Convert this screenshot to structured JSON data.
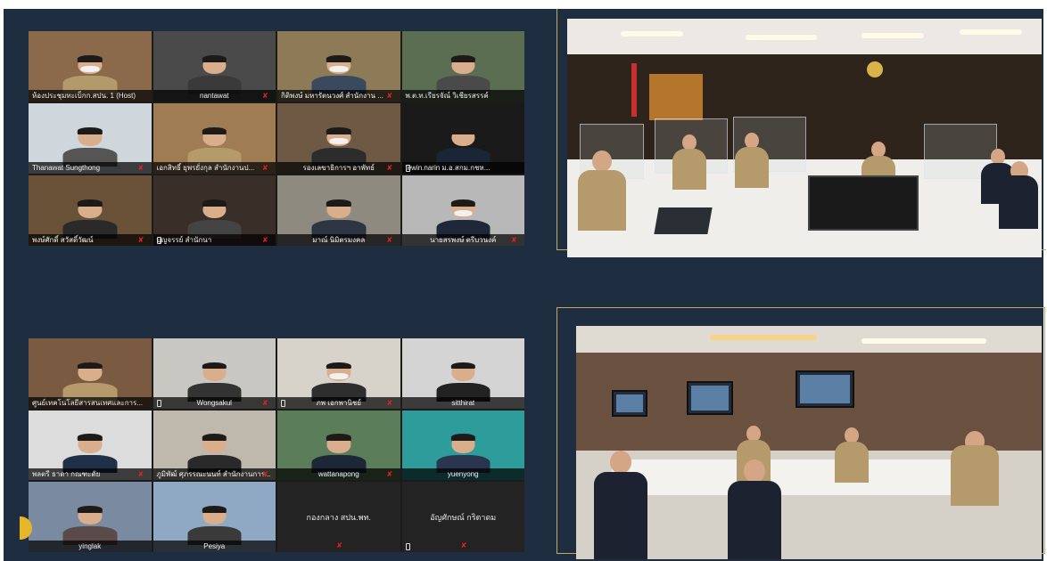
{
  "grid_top": [
    {
      "name": "ห้องประชุมทะเบ็กก.สปน. 1 (Host)",
      "scene": "#8a6a4a",
      "torso": "#b49a6a",
      "mask": true,
      "muted": false,
      "phone": false,
      "align": "left"
    },
    {
      "name": "nantawat",
      "scene": "#4a4a4a",
      "torso": "#3a3a3a",
      "mask": false,
      "muted": true,
      "phone": false,
      "align": "center"
    },
    {
      "name": "กิติพงษ์ มหารัตนวงศ์ สำนักงาน ...",
      "scene": "#8d7b58",
      "torso": "#3a4a5e",
      "mask": true,
      "muted": true,
      "phone": false,
      "align": "left"
    },
    {
      "name": "พ.ต.ท.เรียรจัณ์ วิเชียรสรรค์",
      "scene": "#5c6e52",
      "torso": "#4a4a4a",
      "mask": false,
      "muted": false,
      "phone": false,
      "align": "left"
    },
    {
      "name": "Thanawat Sungthong",
      "scene": "#cfd6dc",
      "torso": "#555",
      "mask": false,
      "muted": true,
      "phone": false,
      "align": "left"
    },
    {
      "name": "เอกสิทธิ์ ยุพรยั่งกุล สำนักงานป...",
      "scene": "#a07c55",
      "torso": "#b59a6c",
      "mask": false,
      "muted": true,
      "phone": false,
      "align": "left"
    },
    {
      "name": "รองเลขาธิการฯ อาพัทธ์",
      "scene": "#6d5944",
      "torso": "#2c2c2c",
      "mask": true,
      "muted": true,
      "phone": false,
      "align": "center"
    },
    {
      "name": "tewin.narin ม.อ.สกม.กชห...",
      "scene": "#1a1a1a",
      "torso": "#1a2535",
      "mask": false,
      "muted": false,
      "phone": true,
      "align": "left"
    },
    {
      "name": "พงษ์ศักดิ์ สวัสดิ์วัฒน์",
      "scene": "#6a5238",
      "torso": "#2a2a2a",
      "mask": false,
      "muted": true,
      "phone": false,
      "align": "left"
    },
    {
      "name": "บุญจรรย์ สำนักนา",
      "scene": "#3a2e28",
      "torso": "#444",
      "mask": false,
      "muted": true,
      "phone": true,
      "align": "left"
    },
    {
      "name": "มาณ์ นิมิตรมงคล",
      "scene": "#8f8a80",
      "torso": "#2e3644",
      "mask": false,
      "muted": true,
      "phone": false,
      "align": "center"
    },
    {
      "name": "นายสรพงษ์ ตรีบวนงค์",
      "scene": "#b8b8b8",
      "torso": "#1f2838",
      "mask": true,
      "muted": true,
      "phone": false,
      "align": "center"
    }
  ],
  "grid_bottom": [
    {
      "name": "ศูนย์เทคโนโลยีสารสนเทศและการ...",
      "scene": "#7b5a42",
      "torso": "#b59a6c",
      "mask": false,
      "muted": false,
      "phone": false,
      "align": "left",
      "empty": false
    },
    {
      "name": "Wongsakul",
      "scene": "#c9c7c2",
      "torso": "#333",
      "mask": false,
      "muted": true,
      "phone": true,
      "align": "center",
      "empty": false
    },
    {
      "name": "ภพ เอกพานิชย์",
      "scene": "#d7d2ca",
      "torso": "#2e2e2e",
      "mask": true,
      "muted": true,
      "phone": true,
      "align": "center",
      "empty": false
    },
    {
      "name": "sitthirat",
      "scene": "#d4d4d4",
      "torso": "#222",
      "mask": false,
      "muted": false,
      "phone": false,
      "align": "center",
      "empty": false
    },
    {
      "name": "พลตรี ธาดา กณฑะดัย",
      "scene": "#dcdcdc",
      "torso": "#203048",
      "mask": false,
      "muted": true,
      "phone": false,
      "align": "left",
      "empty": false
    },
    {
      "name": "ภูมิพัฒ์ ศุภรรณะนนท์ สำนักงานการ...",
      "scene": "#bfb8ad",
      "torso": "#2a2a2a",
      "mask": false,
      "muted": true,
      "phone": false,
      "align": "left",
      "empty": false
    },
    {
      "name": "wattanapong",
      "scene": "#5b7d5a",
      "torso": "#1c2738",
      "mask": false,
      "muted": true,
      "phone": false,
      "align": "center",
      "empty": false
    },
    {
      "name": "yuenyong",
      "scene": "#2e9c9a",
      "torso": "#2a3550",
      "mask": false,
      "muted": false,
      "phone": false,
      "align": "center",
      "empty": false
    },
    {
      "name": "yinglak",
      "scene": "#7a8aa0",
      "torso": "#5a4a4a",
      "mask": false,
      "muted": false,
      "phone": false,
      "align": "center",
      "empty": false
    },
    {
      "name": "Pesiya",
      "scene": "#8fa8c4",
      "torso": "#3a3a3a",
      "mask": false,
      "muted": false,
      "phone": false,
      "align": "center",
      "empty": false
    },
    {
      "name": "กองกลาง สปน.พท.",
      "scene": "#232323",
      "torso": "#232323",
      "mask": false,
      "muted": true,
      "phone": false,
      "align": "center",
      "empty": true
    },
    {
      "name": "อัญศักษณ์ กริตาดม",
      "scene": "#232323",
      "torso": "#232323",
      "mask": false,
      "muted": true,
      "phone": true,
      "align": "center",
      "empty": true
    }
  ],
  "colors": {
    "background": "#1f2d40",
    "frame_gold": "#c5a961",
    "mute_red": "#e02020",
    "logo_yellow": "#e6b62a"
  },
  "icons": {
    "mute": "mic-muted-icon",
    "phone": "phone-icon"
  }
}
